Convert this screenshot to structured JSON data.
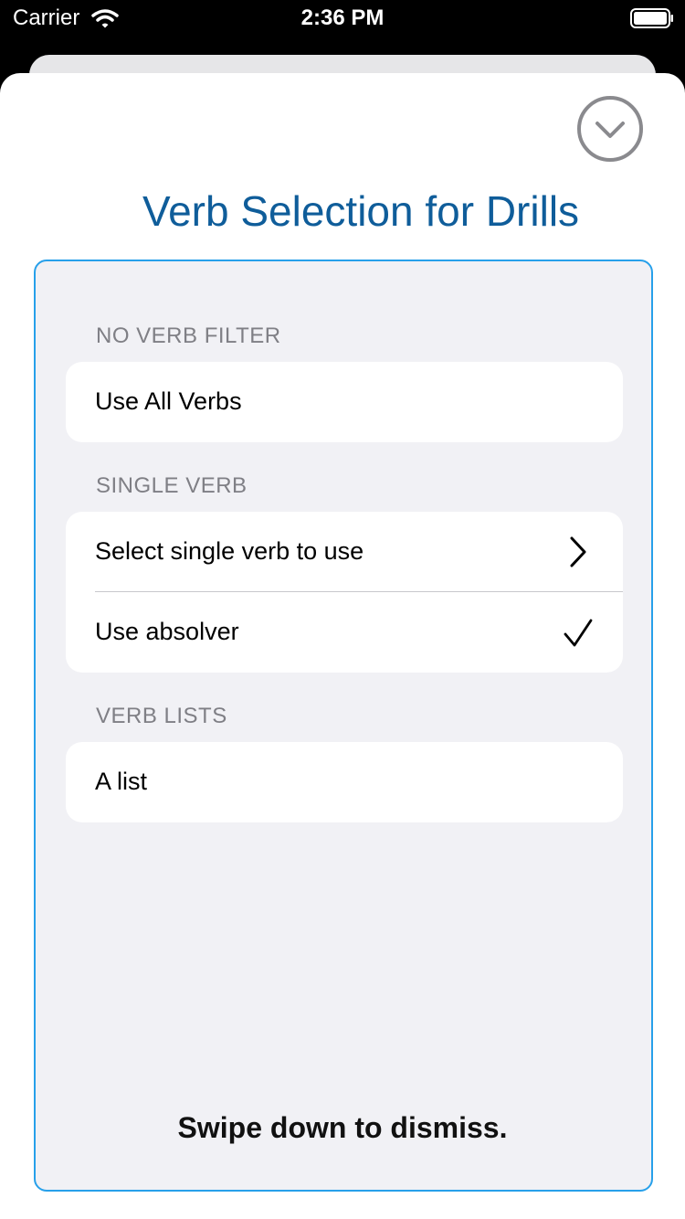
{
  "status_bar": {
    "carrier": "Carrier",
    "time": "2:36 PM",
    "wifi_icon": "wifi-icon",
    "battery_icon": "battery-icon"
  },
  "sheet": {
    "title": "Verb Selection for Drills",
    "dismiss_icon": "chevron-down-circle-icon",
    "footer_hint": "Swipe down to dismiss."
  },
  "sections": [
    {
      "header": "NO VERB FILTER",
      "rows": [
        {
          "label": "Use All Verbs",
          "accessory": "none"
        }
      ]
    },
    {
      "header": "SINGLE VERB",
      "rows": [
        {
          "label": "Select single verb to use",
          "accessory": "chevron-right-icon"
        },
        {
          "label": "Use absolver",
          "accessory": "checkmark-icon"
        }
      ]
    },
    {
      "header": "VERB LISTS",
      "rows": [
        {
          "label": "A list",
          "accessory": "none"
        }
      ]
    }
  ],
  "colors": {
    "title": "#0f5d9a",
    "panel_border": "#27a0ea",
    "panel_background": "#f1f1f5",
    "section_header": "#7f7f85"
  }
}
